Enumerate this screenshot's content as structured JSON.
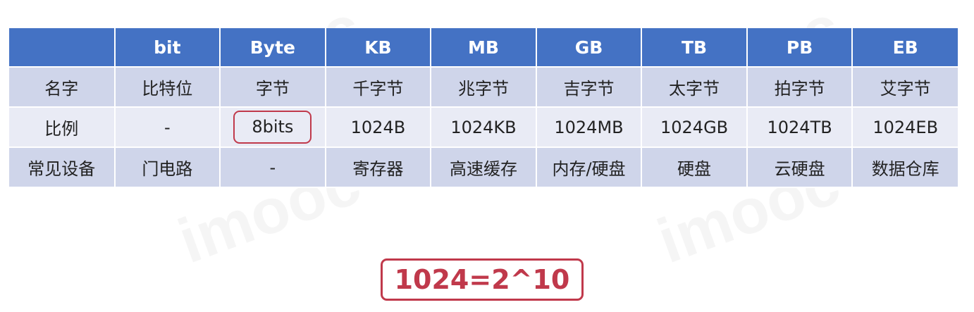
{
  "table": {
    "headers": [
      "",
      "bit",
      "Byte",
      "KB",
      "MB",
      "GB",
      "TB",
      "PB",
      "EB"
    ],
    "rows": [
      [
        "名字",
        "比特位",
        "字节",
        "千字节",
        "兆字节",
        "吉字节",
        "太字节",
        "拍字节",
        "艾字节"
      ],
      [
        "比例",
        "-",
        "8bits",
        "1024B",
        "1024KB",
        "1024MB",
        "1024GB",
        "1024TB",
        "1024EB"
      ],
      [
        "常见设备",
        "门电路",
        "-",
        "寄存器",
        "高速缓存",
        "内存/硬盘",
        "硬盘",
        "云硬盘",
        "数据仓库"
      ]
    ]
  },
  "formula": "1024=2^10",
  "watermark": "imooc",
  "colors": {
    "header_bg": "#4472c4",
    "row_dark": "#cfd5ea",
    "row_light": "#e9ebf5",
    "highlight": "#c0394b"
  }
}
